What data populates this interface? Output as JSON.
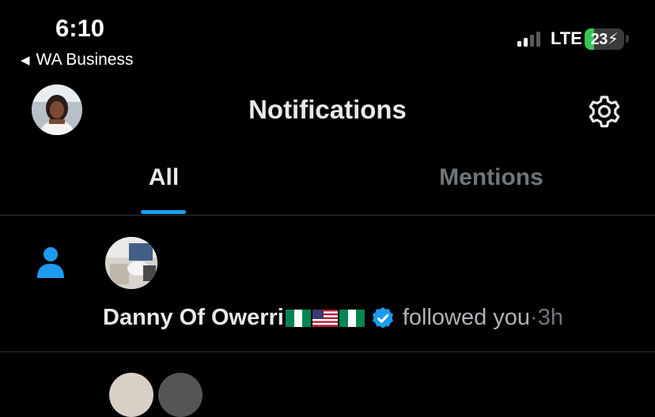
{
  "status_bar": {
    "time": "6:10",
    "back_app": "WA Business",
    "network": "LTE",
    "battery": "23",
    "battery_level": 0.23
  },
  "header": {
    "title": "Notifications"
  },
  "tabs": [
    {
      "label": "All",
      "selected": true
    },
    {
      "label": "Mentions",
      "selected": false
    }
  ],
  "notifications": [
    {
      "type": "follow",
      "user_name": "Danny Of Owerri",
      "flags": [
        "nigeria-flag",
        "us-flag",
        "nigeria-flag"
      ],
      "verified": true,
      "action": "followed you",
      "separator": " · ",
      "time": "3h"
    }
  ],
  "colors": {
    "background": "#000000",
    "accent": "#1d9bf0",
    "primary_text": "#e7e9ea",
    "secondary_text": "#71767b",
    "battery_green": "#34c759"
  }
}
